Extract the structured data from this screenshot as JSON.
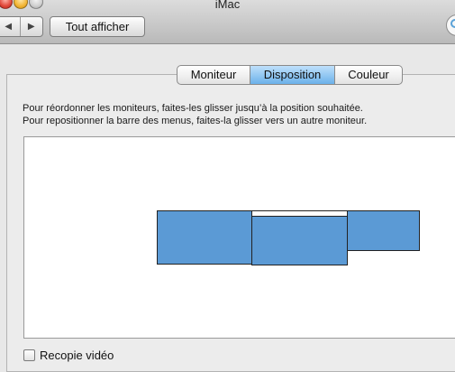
{
  "window": {
    "title": "iMac"
  },
  "toolbar": {
    "back_icon": "triangle-left-icon",
    "forward_icon": "triangle-right-icon",
    "back_glyph": "◀",
    "forward_glyph": "▶",
    "show_all_label": "Tout afficher"
  },
  "tabs": [
    {
      "label": "Moniteur",
      "selected": false
    },
    {
      "label": "Disposition",
      "selected": true
    },
    {
      "label": "Couleur",
      "selected": false
    }
  ],
  "instructions": {
    "line1": "Pour réordonner les moniteurs, faites-les glisser jusqu’à la position souhaitée.",
    "line2": "Pour repositionner la barre des menus, faites-la glisser vers un autre moniteur."
  },
  "displays": {
    "monitor_color": "#5b9ad5",
    "count": 3,
    "menu_bar_on": "display-2"
  },
  "mirror": {
    "label": "Recopie vidéo",
    "checked": false
  }
}
